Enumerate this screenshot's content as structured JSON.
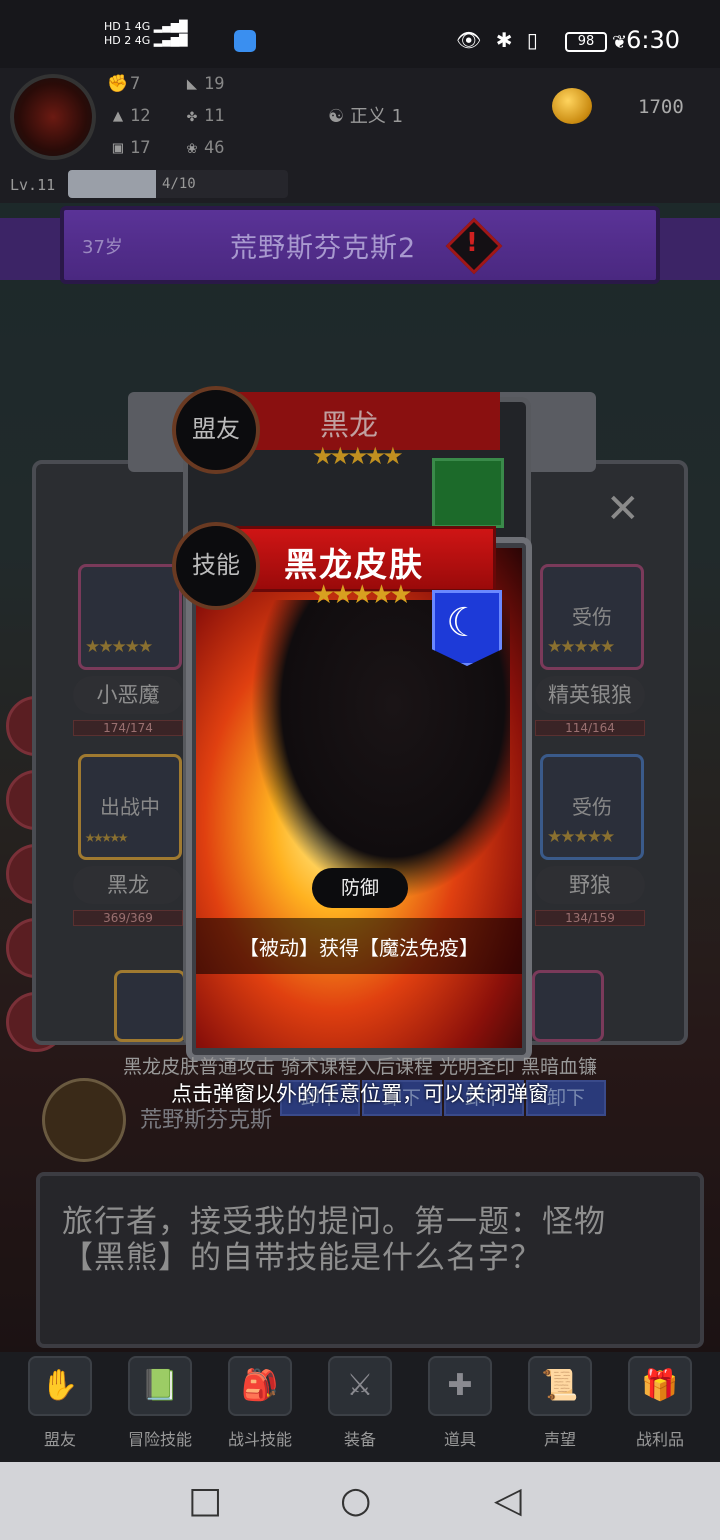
{
  "status": {
    "sim1": "HD 1",
    "sim2": "HD 2",
    "net1": "4G",
    "net2": "4G",
    "battery": "98",
    "time": "6:30"
  },
  "player": {
    "stats_left": [
      "7",
      "12",
      "17"
    ],
    "stats_right": [
      "19",
      "11",
      "46"
    ],
    "justice": "正义 1",
    "gold": "1700",
    "level": "Lv.11",
    "xp_text": "4/10",
    "xp_fraction": 0.4
  },
  "banner": {
    "age": "37岁",
    "title": "荒野斯芬克斯2",
    "alert": "!"
  },
  "panel": {
    "close": "✕",
    "left_slots": [
      {
        "tag": "",
        "name": "小恶魔",
        "hp": "174/174",
        "stars": "★★★★★"
      },
      {
        "tag": "出战中",
        "name": "黑龙",
        "hp": "369/369",
        "stars": "★★★★★"
      }
    ],
    "right_slots": [
      {
        "tag": "受伤",
        "name": "精英银狼",
        "hp": "114/164",
        "stars": "★★★★★"
      },
      {
        "tag": "受伤",
        "name": "野狼",
        "hp": "134/159",
        "stars": "★★★★★"
      }
    ]
  },
  "back_card": {
    "badge": "盟友",
    "title": "黑龙",
    "stars": "★★★★★"
  },
  "front_card": {
    "badge": "技能",
    "title": "黑龙皮肤",
    "stars": "★★★★★",
    "type": "防御",
    "description": "【被动】获得【魔法免疫】",
    "moon_icon": "☾"
  },
  "overlay": {
    "dim_line": "黑龙皮肤普通攻击 骑术课程入后课程 光明圣印 黑暗血镰",
    "hint": "点击弹窗以外的任意位置，可以关闭弹窗",
    "buttons": [
      "卸下",
      "卸下",
      "卸下",
      "卸下"
    ],
    "zone": "荒野斯芬克斯"
  },
  "dialog": {
    "line1": "旅行者，接受我的提问。第一题：怪物",
    "line2": "【黑熊】的自带技能是什么名字？"
  },
  "menu": [
    {
      "label": "盟友",
      "icon": "gauntlet-icon",
      "glyph": "✋"
    },
    {
      "label": "冒险技能",
      "icon": "book-icon",
      "glyph": "📗"
    },
    {
      "label": "战斗技能",
      "icon": "backpack-icon",
      "glyph": "🎒"
    },
    {
      "label": "装备",
      "icon": "swords-icon",
      "glyph": "⚔"
    },
    {
      "label": "道具",
      "icon": "bag-icon",
      "glyph": "✚"
    },
    {
      "label": "声望",
      "icon": "scroll-icon",
      "glyph": "📜"
    },
    {
      "label": "战利品",
      "icon": "chest-icon",
      "glyph": "🎁"
    }
  ],
  "nav": {
    "recent": "□",
    "home": "○",
    "back": "◁"
  }
}
